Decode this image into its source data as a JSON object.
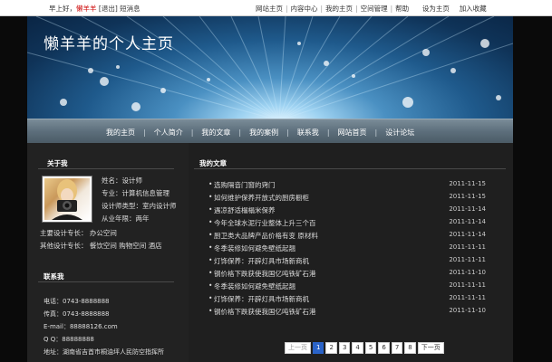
{
  "topbar": {
    "greeting": "早上好，",
    "username": "懒羊羊",
    "logout": "[退出]",
    "messages": "短消息",
    "links": [
      "网站主页",
      "内容中心",
      "我的主页",
      "空间管理",
      "帮助",
      "设为主页",
      "加入收藏"
    ]
  },
  "banner": {
    "title": "懒羊羊的个人主页"
  },
  "nav": {
    "items": [
      "我的主页",
      "个人简介",
      "我的文章",
      "我的案例",
      "联系我",
      "网站首页",
      "设计论坛"
    ]
  },
  "about": {
    "title": "关于我",
    "profile": [
      "姓名：设计师",
      "专业：计算机信息管理",
      "设计师类型：室内设计师",
      "从业年限：两年"
    ],
    "specialty_main": "主要设计专长：  办公空间",
    "specialty_other": "其他设计专长：  餐饮空间   购物空间  酒店"
  },
  "contact": {
    "title": "联系我",
    "lines": [
      "电话：0743-8888888",
      "传真：0743-8888888",
      "E-mail：88888126.com",
      "Q  Q：88888888",
      "地址：湖南省吉首市桐油坪人民防空指挥所"
    ]
  },
  "articles": {
    "title": "我的文章",
    "bullet": "•",
    "items": [
      {
        "title": "选购隔音门窗的窍门",
        "date": "2011-11-15"
      },
      {
        "title": "如何维护保养开放式的厨房橱柜",
        "date": "2011-11-15"
      },
      {
        "title": "遇凉舒适榻榻米保养",
        "date": "2011-11-14"
      },
      {
        "title": "今年全球水泥行业整体上升三个百",
        "date": "2011-11-14"
      },
      {
        "title": "厨卫类大品牌产品价格有变 原材料",
        "date": "2011-11-14"
      },
      {
        "title": "冬季装修如何避免壁纸起翘",
        "date": "2011-11-11"
      },
      {
        "title": "灯饰保养：开辟灯具市场新商机",
        "date": "2011-11-11"
      },
      {
        "title": "钢价格下跌获使我国亿吨铁矿石港",
        "date": "2011-11-10"
      },
      {
        "title": "冬季装修如何避免壁纸起翘",
        "date": "2011-11-11"
      },
      {
        "title": "灯饰保养：开辟灯具市场新商机",
        "date": "2011-11-11"
      },
      {
        "title": "钢价格下跌获使我国亿吨铁矿石港",
        "date": "2011-11-10"
      }
    ]
  },
  "pager": {
    "prev": "上一页",
    "pages": [
      "1",
      "2",
      "3",
      "4",
      "5",
      "6",
      "7",
      "8"
    ],
    "current": "1",
    "next": "下一页"
  },
  "colors": {
    "accent": "#2a63c8",
    "username": "#cc0000",
    "nav": "#5d6f7c"
  }
}
